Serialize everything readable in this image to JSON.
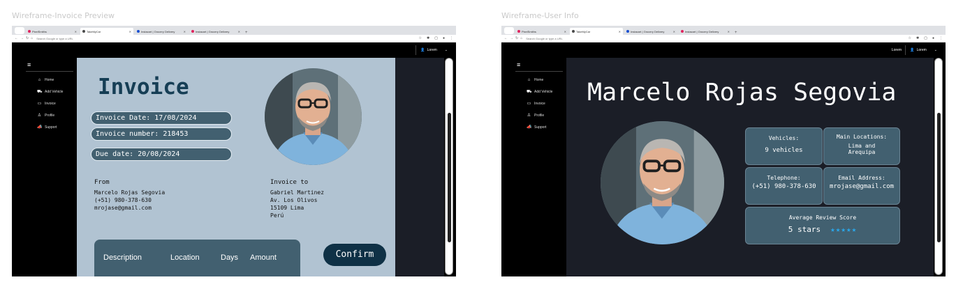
{
  "frames": {
    "invoice_title": "Wireframe-Invoice Preview",
    "user_title": "Wireframe-User Info"
  },
  "browser": {
    "tabs": [
      {
        "label": "PixelSmiths",
        "color": "#e0245e"
      },
      {
        "label": "TakeMyCar",
        "color": "#4a4a4a"
      },
      {
        "label": "Instacart | Grocery Delivery",
        "color": "#1a4fd1"
      },
      {
        "label": "Instacart | Grocery Delivery",
        "color": "#e0245e"
      }
    ],
    "url_placeholder": "Search Google or type a URL"
  },
  "app": {
    "user_label": "Lorem",
    "top_link": "Lorem",
    "nav": [
      {
        "label": "Home",
        "icon": "home-icon"
      },
      {
        "label": "Add Vehicle",
        "icon": "car-icon"
      },
      {
        "label": "Invoice",
        "icon": "folder-icon"
      },
      {
        "label": "Profile",
        "icon": "user-icon"
      },
      {
        "label": "Support",
        "icon": "megaphone-icon"
      }
    ]
  },
  "invoice": {
    "title": "Invoice",
    "invoice_date": "Invoice Date: 17/08/2024",
    "invoice_number": "Invoice number: 218453",
    "due_date": "Due date: 20/08/2024",
    "from_label": "From",
    "from_lines": [
      "Marcelo Rojas Segovia",
      "(+51) 980-378-630",
      "mrojase@gmail.com"
    ],
    "to_label": "Invoice to",
    "to_lines": [
      "Gabriel Martinez",
      "Av. Los Olivos",
      "15109 Lima",
      "Perú"
    ],
    "columns": [
      "Description",
      "Location",
      "Days",
      "Amount"
    ],
    "confirm_label": "Confirm"
  },
  "user": {
    "name": "Marcelo Rojas Segovia",
    "vehicles_label": "Vehicles:",
    "vehicles_value": "9 vehicles",
    "locations_label": "Main Locations:",
    "locations_value_1": "Lima and",
    "locations_value_2": "Arequipa",
    "phone_label": "Telephone:",
    "phone_value": "(+51) 980-378-630",
    "email_label": "Email Address:",
    "email_value": "mrojase@gmail.com",
    "score_label": "Average Review Score",
    "score_value": "5 stars",
    "stars": "★★★★★",
    "star_rating": 5,
    "star_color": "#2aa7ea"
  }
}
